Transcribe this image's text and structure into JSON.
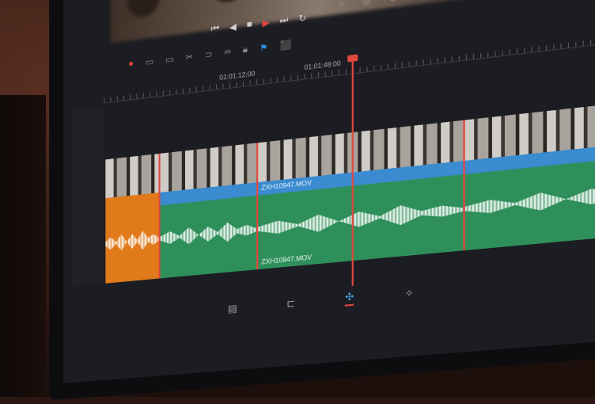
{
  "timeline": {
    "timecodes": [
      "01:01:12:00",
      "01:01:48:00"
    ],
    "clips": [
      {
        "name": "ZXH10947.MOV"
      },
      {
        "name": "ZXH10947.MOV"
      }
    ]
  },
  "icons": {
    "transport": [
      "skip-back-icon",
      "step-back-icon",
      "stop-icon",
      "play-icon",
      "skip-forward-icon",
      "loop-icon"
    ],
    "tools": [
      "razor-icon",
      "link-icon",
      "lock-icon",
      "flag-icon",
      "marker-icon"
    ],
    "pages": [
      "media-page-icon",
      "cut-page-icon",
      "edit-page-icon",
      "fusion-page-icon"
    ]
  },
  "colors": {
    "playhead": "#e2473d",
    "video_clip": "#3a8bd0",
    "audio_clip": "#2f8f5a",
    "orange_clip": "#e07a1a",
    "active_page": "#40b0e8"
  }
}
